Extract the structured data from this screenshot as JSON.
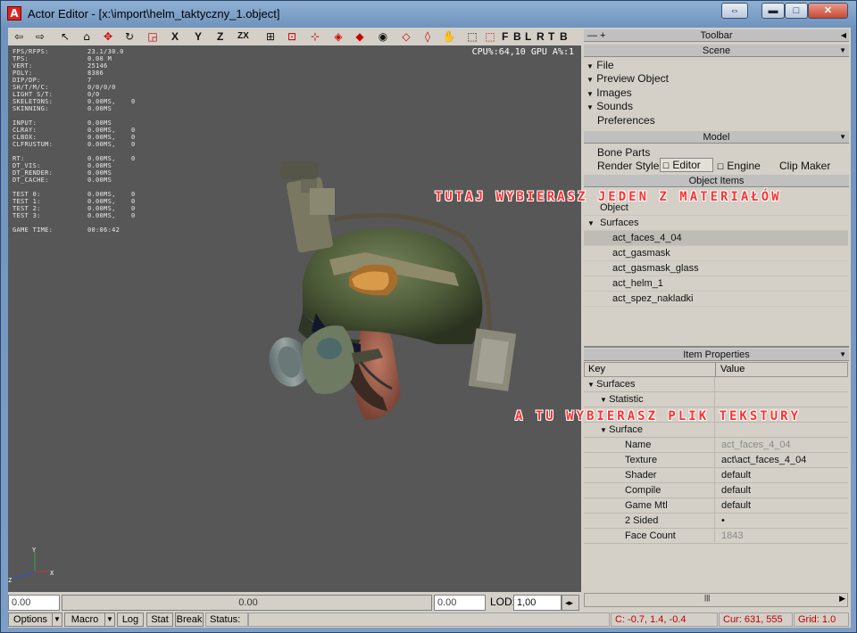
{
  "window": {
    "title": "Actor Editor - [x:\\import\\helm_taktyczny_1.object]",
    "app_icon": "A",
    "buttons": {
      "restore2": "⇔",
      "minimize": "▬",
      "maximize": "□",
      "close": "✕"
    }
  },
  "toolbar": {
    "icons": [
      "arrow-left-icon",
      "arrow-right-icon",
      "select-icon",
      "object-icon",
      "move-icon",
      "rotate-icon",
      "scale-icon"
    ],
    "axis_labels": [
      "X",
      "Y",
      "Z",
      "ZX"
    ],
    "view_labels": [
      "F",
      "B",
      "L",
      "R",
      "T",
      "B"
    ]
  },
  "viewport": {
    "cpu": "CPU%:64,10 GPU A%:1",
    "stats": [
      [
        "FPS/RFPS:",
        "23.1/30.0",
        ""
      ],
      [
        "TPS:",
        "0.00 M",
        ""
      ],
      [
        "VERT:",
        "25146",
        ""
      ],
      [
        "POLY:",
        "8386",
        ""
      ],
      [
        "DIP/DP:",
        "7",
        ""
      ],
      [
        "SH/T/M/C:",
        "0/0/0/0",
        ""
      ],
      [
        "LIGHT S/T:",
        "0/0",
        ""
      ],
      [
        "SKELETONS:",
        "0.00MS,",
        "0"
      ],
      [
        "SKINNING:",
        "0.00MS",
        ""
      ],
      [
        "",
        "",
        ""
      ],
      [
        "INPUT:",
        "0.00MS",
        ""
      ],
      [
        "CLRAY:",
        "0.00MS,",
        "0"
      ],
      [
        "CLBOX:",
        "0.00MS,",
        "0"
      ],
      [
        "CLFRUSTUM:",
        "0.00MS,",
        "0"
      ],
      [
        "",
        "",
        ""
      ],
      [
        " RT:",
        "0.00MS,",
        "0"
      ],
      [
        " DT_VIS:",
        "0.00MS",
        ""
      ],
      [
        " DT_RENDER:",
        "0.00MS",
        ""
      ],
      [
        " DT_CACHE:",
        "0.00MS",
        ""
      ],
      [
        "",
        "",
        ""
      ],
      [
        "TEST 0:",
        "0.00MS,",
        "0"
      ],
      [
        "TEST 1:",
        "0.00MS,",
        "0"
      ],
      [
        "TEST 2:",
        "0.00MS,",
        "0"
      ],
      [
        "TEST 3:",
        "0.00MS,",
        "0"
      ],
      [
        "",
        "",
        ""
      ],
      [
        "GAME TIME:",
        "00:06:42",
        ""
      ]
    ],
    "axis": {
      "y": "Y",
      "x": "X",
      "z": "Z"
    }
  },
  "bottom": {
    "left_value": "0.00",
    "mid_value": "0.00",
    "right_value": "0.00",
    "lod_label": "LOD:",
    "lod_value": "1,00"
  },
  "statusbar": {
    "options": "Options",
    "macro": "Macro",
    "log": "Log",
    "stat": "Stat",
    "break": "Break",
    "status_label": "Status:",
    "coords": "C: -0.7, 1.4, -0.4",
    "cursor": "Cur: 631, 555",
    "grid": "Grid: 1.0"
  },
  "panel": {
    "toolbar_header": "Toolbar",
    "scene_header": "Scene",
    "scene_items": [
      "File",
      "Preview Object",
      "Images",
      "Sounds",
      "Preferences"
    ],
    "model_header": "Model",
    "bone_parts": "Bone Parts",
    "render_style_label": "Render Style:",
    "render_options": [
      "Editor",
      "Engine"
    ],
    "clip_maker": "Clip Maker",
    "object_items_header": "Object Items",
    "tree": {
      "object": "Object",
      "surfaces": "Surfaces",
      "surface_list": [
        "act_faces_4_04",
        "act_gasmask",
        "act_gasmask_glass",
        "act_helm_1",
        "act_spez_nakladki"
      ]
    },
    "item_properties_header": "Item Properties",
    "props_columns": {
      "key": "Key",
      "value": "Value"
    },
    "props": [
      {
        "key": "Surfaces",
        "value": "",
        "indent": 0,
        "arrow": true
      },
      {
        "key": "Statistic",
        "value": "",
        "indent": 1,
        "arrow": true
      },
      {
        "key": "",
        "value": "",
        "indent": 0,
        "arrow": false
      },
      {
        "key": "Surface",
        "value": "",
        "indent": 1,
        "arrow": true
      },
      {
        "key": "Name",
        "value": "act_faces_4_04",
        "indent": 2,
        "arrow": false,
        "dim": true
      },
      {
        "key": "Texture",
        "value": "act\\act_faces_4_04",
        "indent": 2,
        "arrow": false
      },
      {
        "key": "Shader",
        "value": "default",
        "indent": 2,
        "arrow": false
      },
      {
        "key": "Compile",
        "value": "default",
        "indent": 2,
        "arrow": false
      },
      {
        "key": "Game Mtl",
        "value": "default",
        "indent": 2,
        "arrow": false
      },
      {
        "key": "2 Sided",
        "value": "•",
        "indent": 2,
        "arrow": false
      },
      {
        "key": "Face Count",
        "value": "1843",
        "indent": 2,
        "arrow": false,
        "dim": true
      }
    ]
  },
  "annotations": {
    "material": "TUTAJ WYBIERASZ JEDEN Z MATERIAŁÓW",
    "texture": "A TU WYBIERASZ PLIK TEKSTURY"
  },
  "colors": {
    "annotation": "#ff3030",
    "viewport_bg": "#575757",
    "panel_bg": "#d4d0c8"
  }
}
